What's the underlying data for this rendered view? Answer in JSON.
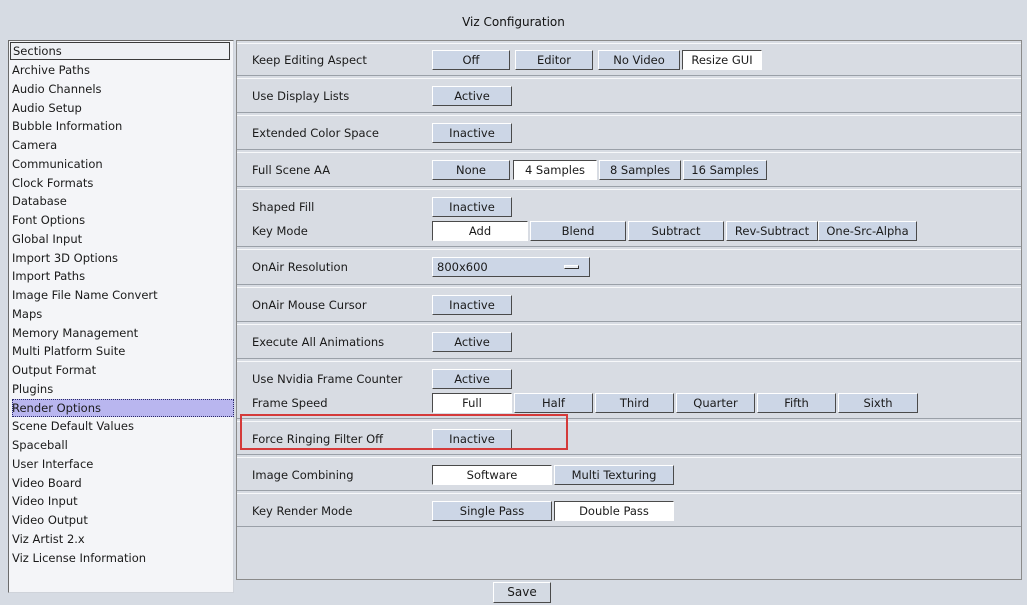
{
  "window": {
    "title": "Viz Configuration"
  },
  "sidebar": {
    "header": "Sections",
    "items": [
      {
        "label": "Archive Paths"
      },
      {
        "label": "Audio Channels"
      },
      {
        "label": "Audio Setup"
      },
      {
        "label": "Bubble Information"
      },
      {
        "label": "Camera"
      },
      {
        "label": "Communication"
      },
      {
        "label": "Clock Formats"
      },
      {
        "label": "Database"
      },
      {
        "label": "Font Options"
      },
      {
        "label": "Global Input"
      },
      {
        "label": "Import 3D Options"
      },
      {
        "label": "Import Paths"
      },
      {
        "label": "Image File Name Convert"
      },
      {
        "label": "Maps"
      },
      {
        "label": "Memory Management"
      },
      {
        "label": "Multi Platform Suite"
      },
      {
        "label": "Output Format"
      },
      {
        "label": "Plugins"
      },
      {
        "label": "Render Options"
      },
      {
        "label": "Scene Default Values"
      },
      {
        "label": "Spaceball"
      },
      {
        "label": "User Interface"
      },
      {
        "label": "Video Board"
      },
      {
        "label": "Video Input"
      },
      {
        "label": "Video Output"
      },
      {
        "label": "Viz Artist 2.x"
      },
      {
        "label": "Viz License Information"
      }
    ],
    "selected": "Render Options"
  },
  "settings": {
    "keep_editing_aspect": {
      "label": "Keep Editing Aspect",
      "options": [
        "Off",
        "Editor",
        "No Video",
        "Resize GUI"
      ],
      "selected": "Resize GUI"
    },
    "use_display_lists": {
      "label": "Use Display Lists",
      "value": "Active"
    },
    "extended_color_space": {
      "label": "Extended Color Space",
      "value": "Inactive"
    },
    "full_scene_aa": {
      "label": "Full Scene AA",
      "options": [
        "None",
        "4 Samples",
        "8 Samples",
        "16 Samples"
      ],
      "selected": "4 Samples"
    },
    "shaped_fill": {
      "label": "Shaped Fill",
      "value": "Inactive"
    },
    "key_mode": {
      "label": "Key Mode",
      "options": [
        "Add",
        "Blend",
        "Subtract",
        "Rev-Subtract",
        "One-Src-Alpha"
      ],
      "selected": "Add"
    },
    "onair_resolution": {
      "label": "OnAir Resolution",
      "value": "800x600"
    },
    "onair_mouse_cursor": {
      "label": "OnAir Mouse Cursor",
      "value": "Inactive"
    },
    "execute_all_animations": {
      "label": "Execute All Animations",
      "value": "Active"
    },
    "use_nvidia_frame_counter": {
      "label": "Use Nvidia Frame Counter",
      "value": "Active"
    },
    "frame_speed": {
      "label": "Frame Speed",
      "options": [
        "Full",
        "Half",
        "Third",
        "Quarter",
        "Fifth",
        "Sixth"
      ],
      "selected": "Full"
    },
    "force_ringing_filter_off": {
      "label": "Force Ringing Filter Off",
      "value": "Inactive"
    },
    "image_combining": {
      "label": "Image Combining",
      "options": [
        "Software",
        "Multi Texturing"
      ],
      "selected": "Software"
    },
    "key_render_mode": {
      "label": "Key Render Mode",
      "options": [
        "Single Pass",
        "Double Pass"
      ],
      "selected": "Double Pass"
    }
  },
  "footer": {
    "save_label": "Save"
  },
  "colors": {
    "highlight": "#d43a3a",
    "button": "#ccd6e6",
    "selected_item": "#b9b6ef"
  }
}
